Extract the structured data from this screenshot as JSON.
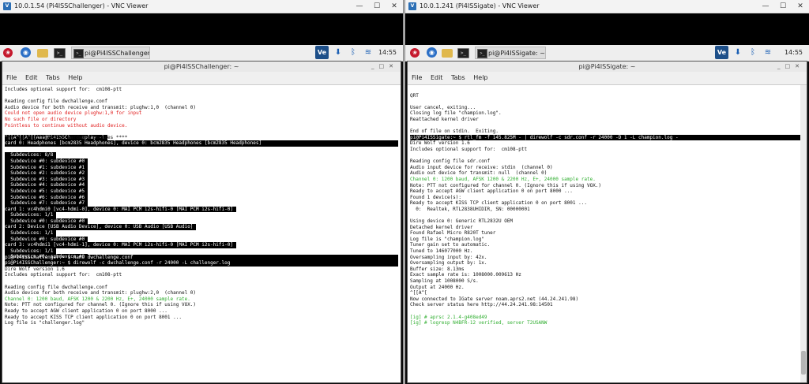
{
  "left": {
    "vnc_title": "10.0.1.54 (Pi4ISSChallenger) - VNC Viewer",
    "task_label": "pi@Pi4ISSChallenger: ~",
    "clock": "14:55",
    "term_title": "pi@Pi4ISSChallenger: ~",
    "menu": [
      "File",
      "Edit",
      "Tabs",
      "Help"
    ],
    "lines": [
      {
        "t": "Includes optional support for:  cm108-ptt",
        "c": ""
      },
      {
        "t": "",
        "c": ""
      },
      {
        "t": "Reading config file dwchallenge.conf",
        "c": ""
      },
      {
        "t": "Audio device for both receive and transmit: plughw:1,0  (channel 0)",
        "c": ""
      },
      {
        "t": "Could not open audio device plughw:1,0 for input",
        "c": "red"
      },
      {
        "t": "No such file or directory",
        "c": "red"
      },
      {
        "t": "Pointless to continue without audio device.",
        "c": "red"
      },
      {
        "t": "^[[A^[[A^[[Aaa@Pi4ISSCh    aplay -l",
        "c": "hlp"
      },
      {
        "t": "**** List of PLAYBACK Hardware Devices ****",
        "c": ""
      },
      {
        "t": "card 0: Headphones [bcm2835 Headphones], device 0: bcm2835 Headphones [bcm2835 Headphones]",
        "c": "hl"
      },
      {
        "t": "  Subdevices: 8/8",
        "c": "hlp"
      },
      {
        "t": "  Subdevice #0: subdevice #0",
        "c": "hlp"
      },
      {
        "t": "  Subdevice #1: subdevice #1",
        "c": "hlp"
      },
      {
        "t": "  Subdevice #2: subdevice #2",
        "c": "hlp"
      },
      {
        "t": "  Subdevice #3: subdevice #3",
        "c": "hlp"
      },
      {
        "t": "  Subdevice #4: subdevice #4",
        "c": "hlp"
      },
      {
        "t": "  Subdevice #5: subdevice #5",
        "c": "hlp"
      },
      {
        "t": "  Subdevice #6: subdevice #6",
        "c": "hlp"
      },
      {
        "t": "  Subdevice #7: subdevice #7",
        "c": "hlp"
      },
      {
        "t": "card 1: vc4hdmi0 [vc4-hdmi-0], device 0: MAI PCM i2s-hifi-0 [MAI PCM i2s-hifi-0]",
        "c": "hlp"
      },
      {
        "t": "  Subdevices: 1/1",
        "c": "hlp"
      },
      {
        "t": "  Subdevice #0: subdevice #0",
        "c": "hlp"
      },
      {
        "t": "card 2: Device [USB Audio Device], device 0: USB Audio [USB Audio]",
        "c": "hlp"
      },
      {
        "t": "  Subdevices: 1/1",
        "c": "hlp"
      },
      {
        "t": "  Subdevice #0: subdevice #0",
        "c": "hlp"
      },
      {
        "t": "card 3: vc4hdmi1 [vc4-hdmi-1], device 0: MAI PCM i2s-hifi-0 [MAI PCM i2s-hifi-0]",
        "c": "hlp"
      },
      {
        "t": "  Subdevices: 1/1",
        "c": "hlp"
      },
      {
        "t": "  Subdevice #0: subdevice #0",
        "c": "hlp"
      },
      {
        "t": "pi@Pi4ISSChallenger:~ $ nano dwchallenge.conf",
        "c": "hl"
      },
      {
        "t": "pi@Pi4ISSChallenger:~ $ direwolf -c dwchallenge.conf -r 24000 -L challenger.log",
        "c": "hl"
      },
      {
        "t": "Dire Wolf version 1.6",
        "c": ""
      },
      {
        "t": "Includes optional support for:  cm108-ptt",
        "c": ""
      },
      {
        "t": "",
        "c": ""
      },
      {
        "t": "Reading config file dwchallenge.conf",
        "c": ""
      },
      {
        "t": "Audio device for both receive and transmit: plughw:2,0  (channel 0)",
        "c": ""
      },
      {
        "t": "Channel 0: 1200 baud, AFSK 1200 & 2200 Hz, E+, 24000 sample rate.",
        "c": "green"
      },
      {
        "t": "Note: PTT not configured for channel 0. (Ignore this if using VOX.)",
        "c": ""
      },
      {
        "t": "Ready to accept AGW client application 0 on port 8000 ...",
        "c": ""
      },
      {
        "t": "Ready to accept KISS TCP client application 0 on port 8001 ...",
        "c": ""
      },
      {
        "t": "Log file is \"challenger.log\"",
        "c": ""
      }
    ]
  },
  "right": {
    "vnc_title": "10.0.1.241 (Pi4ISSigate) - VNC Viewer",
    "task_label": "pi@Pi4ISSigate: ~",
    "clock": "14:55",
    "term_title": "pi@Pi4ISSigate: ~",
    "menu": [
      "File",
      "Edit",
      "Tabs",
      "Help"
    ],
    "lines": [
      {
        "t": "",
        "c": ""
      },
      {
        "t": "QRT",
        "c": ""
      },
      {
        "t": "",
        "c": ""
      },
      {
        "t": "User cancel, exiting...",
        "c": ""
      },
      {
        "t": "Closing log file \"champion.log\".",
        "c": ""
      },
      {
        "t": "Reattached kernel driver",
        "c": ""
      },
      {
        "t": "",
        "c": ""
      },
      {
        "t": "End of file on stdin.  Exiting.",
        "c": ""
      },
      {
        "t": "pi@Pi4ISSigate:~ $ rtl_fm -f 145.825M - | direwolf -c sdr.conf -r 24000 -D 1 -L champion.log -",
        "c": "hl"
      },
      {
        "t": "Dire Wolf version 1.6",
        "c": ""
      },
      {
        "t": "Includes optional support for:  cm108-ptt",
        "c": ""
      },
      {
        "t": "",
        "c": ""
      },
      {
        "t": "Reading config file sdr.conf",
        "c": ""
      },
      {
        "t": "Audio input device for receive: stdin  (channel 0)",
        "c": ""
      },
      {
        "t": "Audio out device for transmit: null  (channel 0)",
        "c": ""
      },
      {
        "t": "Channel 0: 1200 baud, AFSK 1200 & 2200 Hz, E+, 24000 sample rate.",
        "c": "green"
      },
      {
        "t": "Note: PTT not configured for channel 0. (Ignore this if using VOX.)",
        "c": ""
      },
      {
        "t": "Ready to accept AGW client application 0 on port 8000 ...",
        "c": ""
      },
      {
        "t": "Found 1 device(s):",
        "c": ""
      },
      {
        "t": "Ready to accept KISS TCP client application 0 on port 8001 ...",
        "c": ""
      },
      {
        "t": "  0:  Realtek, RTL2838UHIDIR, SN: 00000001",
        "c": ""
      },
      {
        "t": "",
        "c": ""
      },
      {
        "t": "Using device 0: Generic RTL2832U OEM",
        "c": ""
      },
      {
        "t": "Detached kernel driver",
        "c": ""
      },
      {
        "t": "Found Rafael Micro R820T tuner",
        "c": ""
      },
      {
        "t": "Log file is \"champion.log\"",
        "c": ""
      },
      {
        "t": "Tuner gain set to automatic.",
        "c": ""
      },
      {
        "t": "Tuned to 146077000 Hz.",
        "c": ""
      },
      {
        "t": "Oversampling input by: 42x.",
        "c": ""
      },
      {
        "t": "Oversampling output by: 1x.",
        "c": ""
      },
      {
        "t": "Buffer size: 8.13ms",
        "c": ""
      },
      {
        "t": "Exact sample rate is: 1008000.009613 Hz",
        "c": ""
      },
      {
        "t": "Sampling at 1008000 S/s.",
        "c": ""
      },
      {
        "t": "Output at 24000 Hz.",
        "c": ""
      },
      {
        "t": "^[[A^[",
        "c": ""
      },
      {
        "t": "Now connected to IGate server noam.aprs2.net (44.24.241.98)",
        "c": ""
      },
      {
        "t": "Check server status here http://44.24.241.98:14501",
        "c": ""
      },
      {
        "t": "",
        "c": ""
      },
      {
        "t": "[ig] # aprsc 2.1.4-g408ed49",
        "c": "green"
      },
      {
        "t": "[ig] # logresp N4BFR-12 verified, server T2USANW",
        "c": "green"
      }
    ]
  }
}
